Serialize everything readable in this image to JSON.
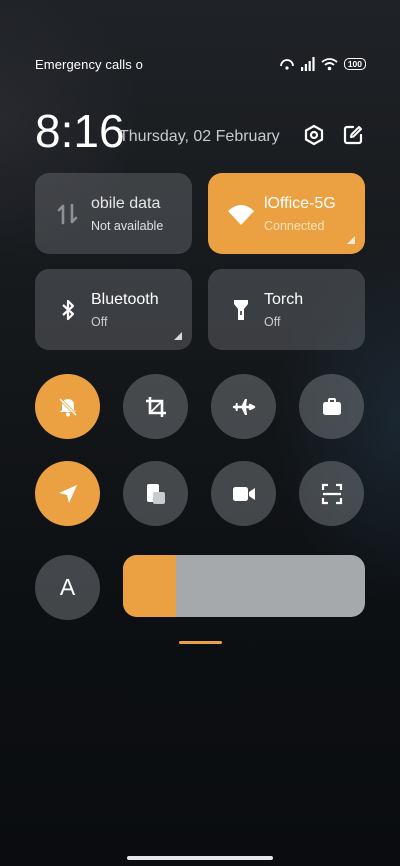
{
  "status_bar": {
    "left_text": "Emergency calls o",
    "battery": "100"
  },
  "header": {
    "time": "8:16",
    "date": "Thursday, 02 February"
  },
  "tiles": [
    {
      "title": "obile data",
      "subtitle": "Not available",
      "state": "off",
      "icon": "mobile-data-icon"
    },
    {
      "title": "lOffice-5G",
      "subtitle": "Connected",
      "state": "on",
      "icon": "wifi-icon"
    },
    {
      "title": "Bluetooth",
      "subtitle": "Off",
      "state": "off",
      "icon": "bluetooth-icon"
    },
    {
      "title": "Torch",
      "subtitle": "Off",
      "state": "off",
      "icon": "torch-icon"
    }
  ],
  "toggles": [
    {
      "icon": "bell-off-icon",
      "state": "on"
    },
    {
      "icon": "crop-icon",
      "state": "off"
    },
    {
      "icon": "airplane-icon",
      "state": "off"
    },
    {
      "icon": "briefcase-icon",
      "state": "off"
    },
    {
      "icon": "location-icon",
      "state": "on"
    },
    {
      "icon": "overlay-icon",
      "state": "off"
    },
    {
      "icon": "video-camera-icon",
      "state": "off"
    },
    {
      "icon": "scan-icon",
      "state": "off"
    }
  ],
  "auto_brightness": {
    "label": "A"
  },
  "brightness": {
    "level": 0.22
  },
  "colors": {
    "accent": "#eba142",
    "tile_gray": "#5a5e62",
    "background": "#111417"
  }
}
